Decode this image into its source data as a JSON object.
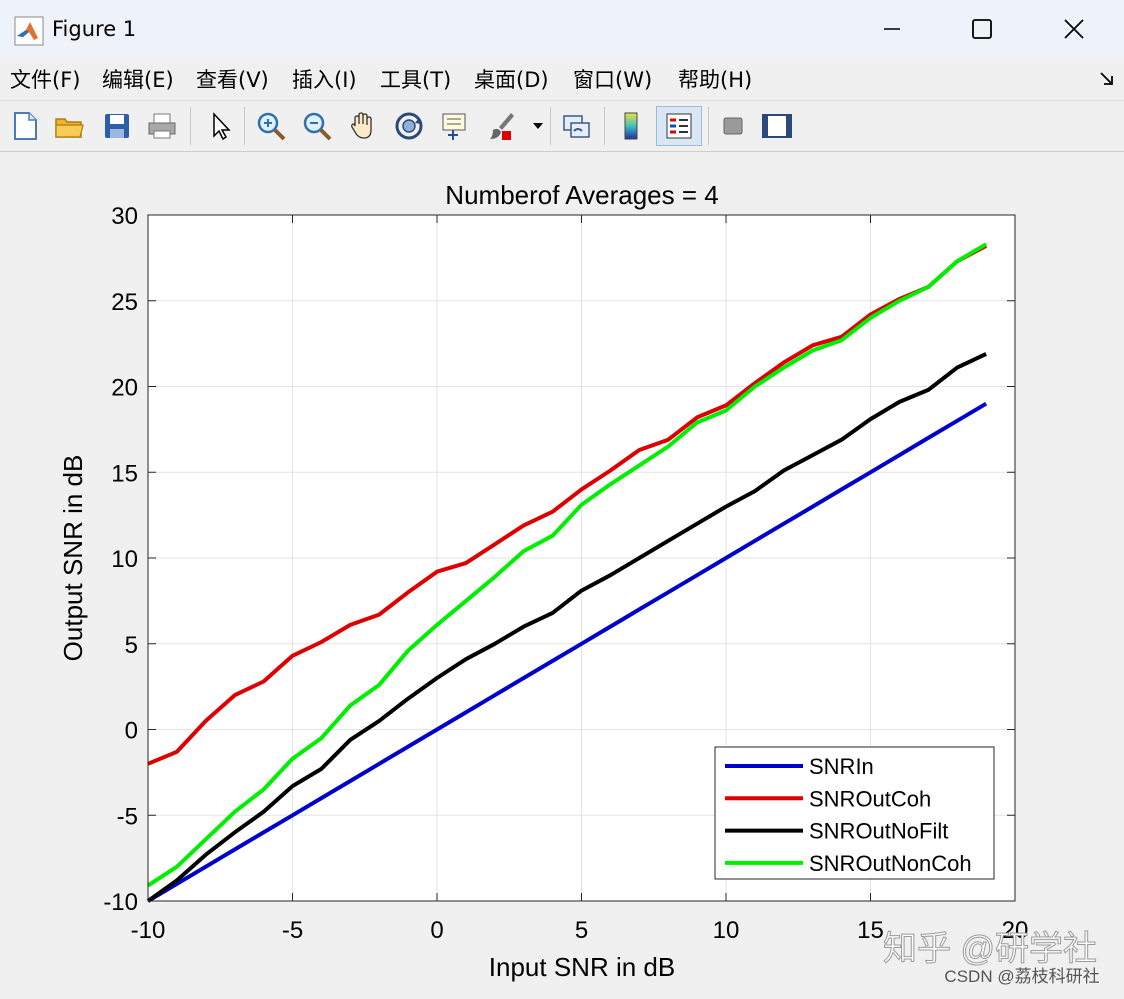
{
  "window": {
    "title": "Figure 1"
  },
  "menu": {
    "items": [
      "文件(F)",
      "编辑(E)",
      "查看(V)",
      "插入(I)",
      "工具(T)",
      "桌面(D)",
      "窗口(W)",
      "帮助(H)"
    ]
  },
  "toolbar": {
    "icons": [
      "new-figure-icon",
      "open-icon",
      "save-icon",
      "print-icon",
      "pointer-icon",
      "zoom-in-icon",
      "zoom-out-icon",
      "pan-hand-icon",
      "rotate-3d-icon",
      "data-cursor-icon",
      "brush-icon",
      "link-plot-icon",
      "colorbar-icon",
      "legend-icon",
      "hide-plot-tools-icon",
      "show-plot-tools-icon"
    ]
  },
  "watermark": {
    "main": "知乎 @研学社",
    "sub": "CSDN @荔枝科研社"
  },
  "colors": {
    "SNRIn": "#0000cc",
    "SNROutCoh": "#dd0000",
    "SNROutNoFilt": "#000000",
    "SNROutNonCoh": "#00ee00"
  },
  "chart_data": {
    "type": "line",
    "title": "Numberof Averages = 4",
    "xlabel": "Input SNR in dB",
    "ylabel": "Output SNR in dB",
    "xlim": [
      -10,
      20
    ],
    "ylim": [
      -10,
      30
    ],
    "xticks": [
      -10,
      -5,
      0,
      5,
      10,
      15,
      20
    ],
    "yticks": [
      -10,
      -5,
      0,
      5,
      10,
      15,
      20,
      25,
      30
    ],
    "grid": true,
    "legend_position": "bottom-right",
    "x": [
      -10,
      -9,
      -8,
      -7,
      -6,
      -5,
      -4,
      -3,
      -2,
      -1,
      0,
      1,
      2,
      3,
      4,
      5,
      6,
      7,
      8,
      9,
      10,
      11,
      12,
      13,
      14,
      15,
      16,
      17,
      18,
      19
    ],
    "series": [
      {
        "name": "SNRIn",
        "values": [
          -10,
          -9,
          -8,
          -7,
          -6,
          -5,
          -4,
          -3,
          -2,
          -1,
          0,
          1,
          2,
          3,
          4,
          5,
          6,
          7,
          8,
          9,
          10,
          11,
          12,
          13,
          14,
          15,
          16,
          17,
          18,
          19
        ]
      },
      {
        "name": "SNROutCoh",
        "values": [
          -2,
          -1.3,
          0.5,
          2.0,
          2.8,
          4.3,
          5.1,
          6.1,
          6.7,
          8.0,
          9.2,
          9.7,
          10.8,
          11.9,
          12.7,
          14.0,
          15.1,
          16.3,
          16.9,
          18.2,
          18.9,
          20.2,
          21.4,
          22.4,
          22.9,
          24.2,
          25.1,
          25.8,
          27.3,
          28.2
        ]
      },
      {
        "name": "SNROutNoFilt",
        "values": [
          -10,
          -8.8,
          -7.3,
          -6.0,
          -4.8,
          -3.3,
          -2.3,
          -0.6,
          0.5,
          1.8,
          3.0,
          4.1,
          5.0,
          6.0,
          6.8,
          8.1,
          9.0,
          10.0,
          11.0,
          12.0,
          13.0,
          13.9,
          15.1,
          16.0,
          16.9,
          18.1,
          19.1,
          19.8,
          21.1,
          21.9
        ]
      },
      {
        "name": "SNROutNonCoh",
        "values": [
          -9.1,
          -8.0,
          -6.4,
          -4.8,
          -3.5,
          -1.7,
          -0.5,
          1.4,
          2.6,
          4.6,
          6.1,
          7.5,
          8.9,
          10.4,
          11.3,
          13.1,
          14.3,
          15.4,
          16.5,
          17.9,
          18.6,
          20.0,
          21.1,
          22.1,
          22.7,
          24.0,
          25.0,
          25.8,
          27.3,
          28.3
        ]
      }
    ]
  }
}
